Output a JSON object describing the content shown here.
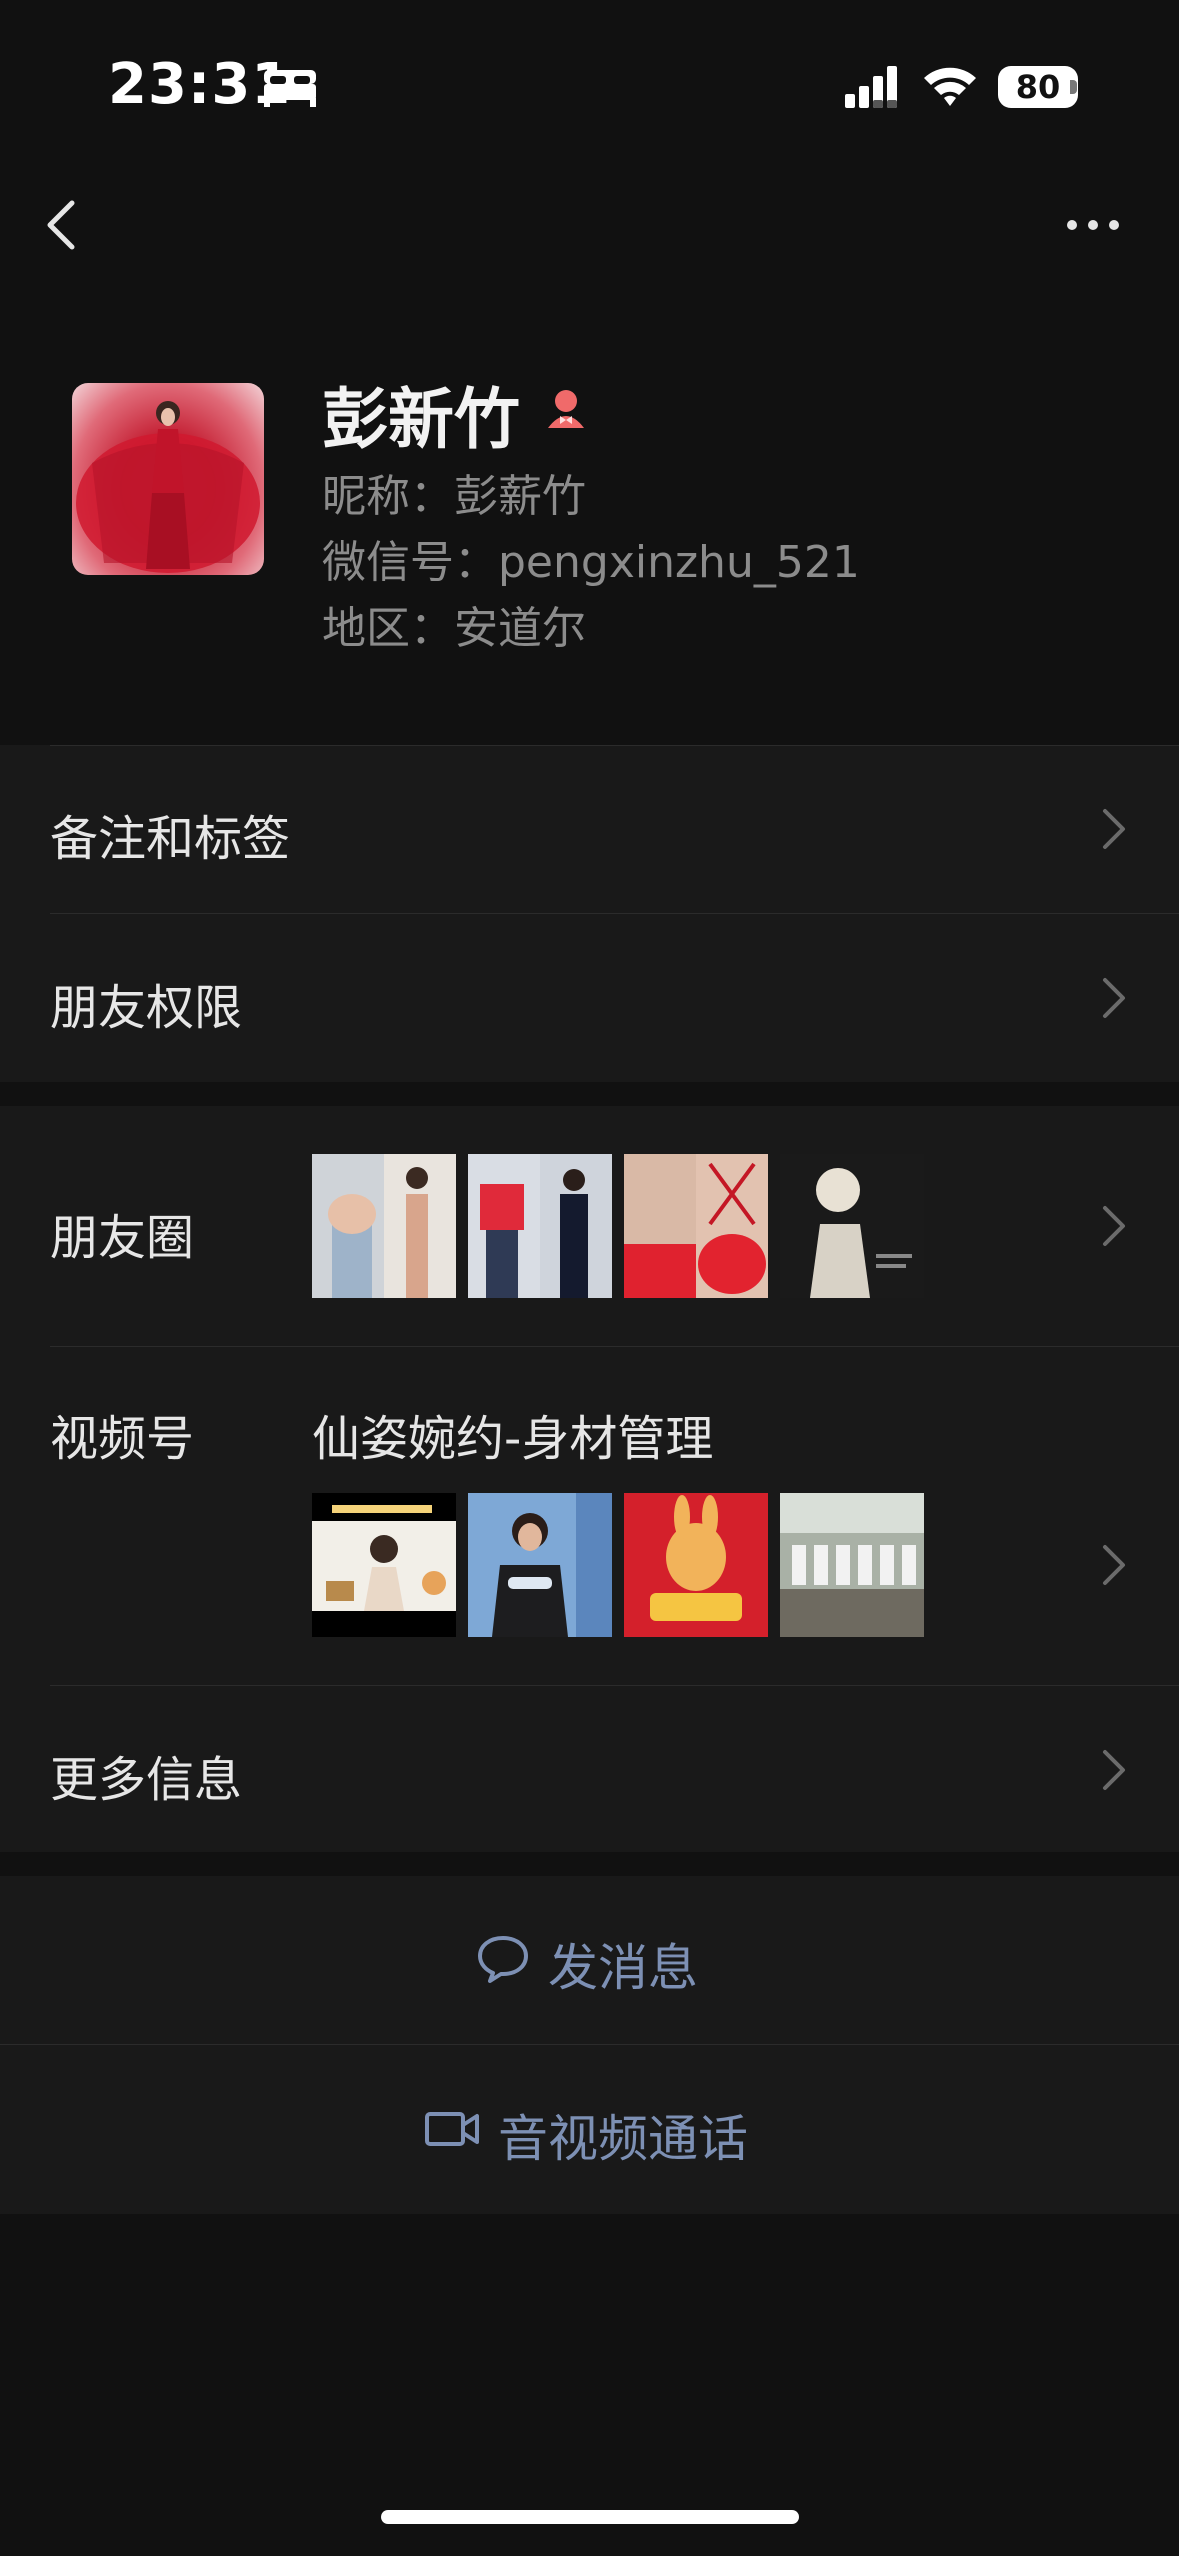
{
  "status_bar": {
    "time": "23:31",
    "battery": "80"
  },
  "profile": {
    "name": "彭新竹",
    "nickname": "昵称：彭薪竹",
    "wechat_id": "微信号：pengxinzhu_521",
    "region": "地区：安道尔"
  },
  "menu": {
    "remarks_tags": "备注和标签",
    "friend_permissions": "朋友权限",
    "moments": "朋友圈",
    "channels": "视频号",
    "channel_name": "仙姿婉约-身材管理",
    "more_info": "更多信息"
  },
  "actions": {
    "send_message": "发消息",
    "av_call": "音视频通话"
  },
  "icons": [
    "bed-icon",
    "signal-icon",
    "wifi-icon",
    "back-icon",
    "more-icon",
    "female-icon",
    "chevron-right-icon",
    "chat-bubble-icon",
    "video-camera-icon"
  ],
  "colors": {
    "background": "#111111",
    "section": "#191919",
    "action_text": "#7d90b4",
    "secondary_text": "#8c8c8c"
  }
}
